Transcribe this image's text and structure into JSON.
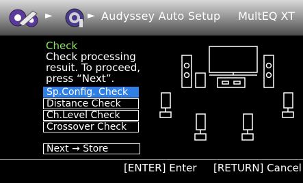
{
  "header": {
    "breadcrumb_arrow": "►",
    "title": "Audyssey Auto Setup",
    "mode": "MultEQ XT"
  },
  "status": {
    "label": "Check",
    "message": "Check processing resuit. To proceed, press “Next”."
  },
  "menu": {
    "items": [
      {
        "label": "Sp.Config. Check"
      },
      {
        "label": "Distance Check"
      },
      {
        "label": "Ch.Level Check"
      },
      {
        "label": "Crossover Check"
      }
    ],
    "next_label": "Next → Store"
  },
  "footer": {
    "enter": "[ENTER] Enter",
    "return": "[RETURN] Cancel"
  },
  "colors": {
    "accent": "#2f7fe5",
    "status_label": "#8fe36b",
    "background": "#000000"
  }
}
